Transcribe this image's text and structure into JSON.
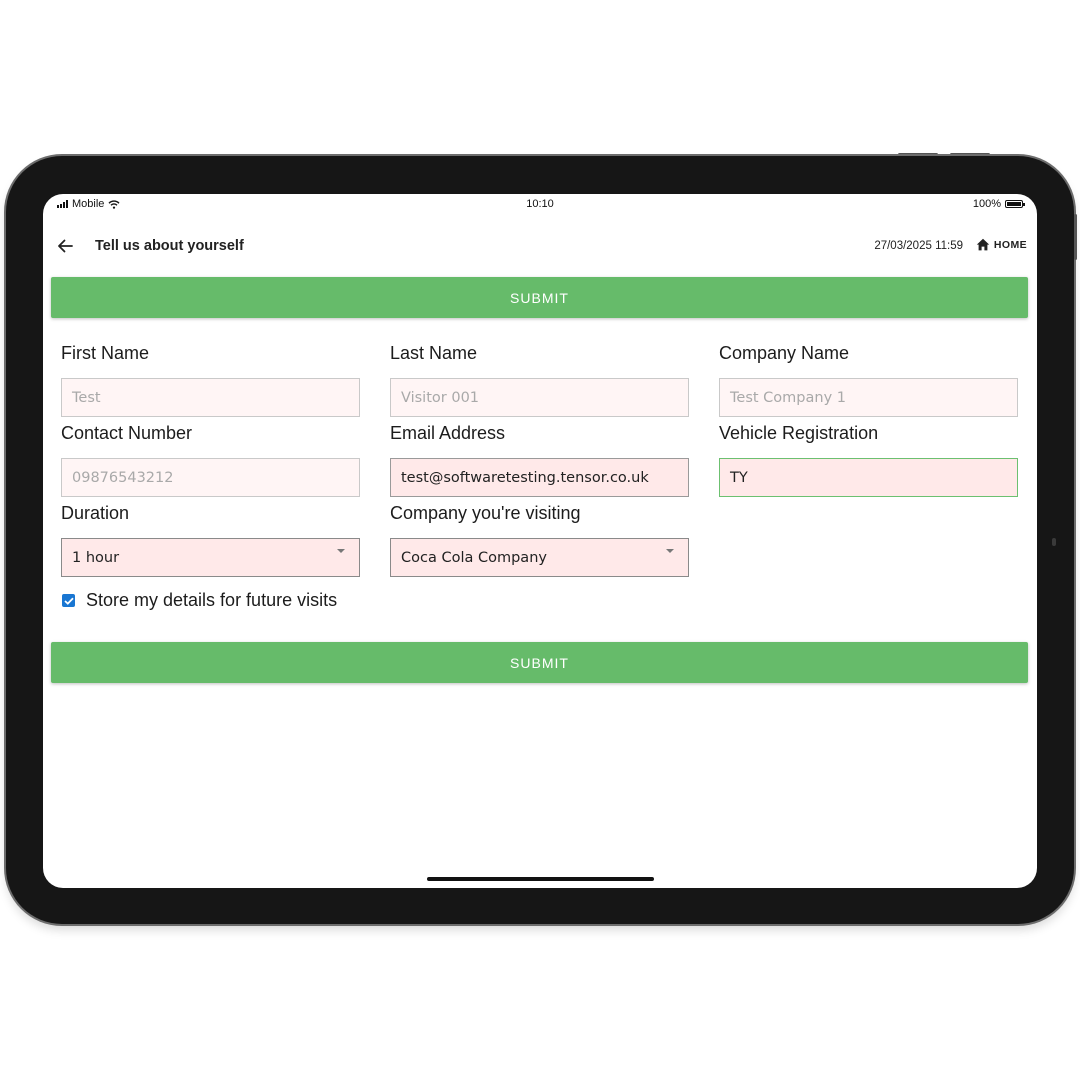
{
  "status_bar": {
    "carrier": "Mobile",
    "time": "10:10",
    "battery": "100%",
    "battery_level": 1.0
  },
  "header": {
    "title": "Tell us about yourself",
    "datetime": "27/03/2025 11:59",
    "home_label": "HOME"
  },
  "submit_label": "SUBMIT",
  "form": {
    "first_name": {
      "label": "First Name",
      "placeholder": "Test"
    },
    "last_name": {
      "label": "Last Name",
      "placeholder": "Visitor 001"
    },
    "company_name": {
      "label": "Company Name",
      "placeholder": "Test Company 1"
    },
    "contact_number": {
      "label": "Contact Number",
      "placeholder": "09876543212"
    },
    "email": {
      "label": "Email Address",
      "value": "test@softwaretesting.tensor.co.uk"
    },
    "vehicle_registration": {
      "label": "Vehicle Registration",
      "value": "TY"
    },
    "duration": {
      "label": "Duration",
      "value": "1 hour"
    },
    "company_visiting": {
      "label": "Company you're visiting",
      "value": "Coca Cola Company"
    },
    "store_details": {
      "label": "Store my details for future visits",
      "checked": true
    }
  },
  "colors": {
    "submit": "#66bb6a",
    "checkbox": "#1976d2",
    "field_bg": "#ffe9e9",
    "valid_border": "#6cc070"
  },
  "icons": {
    "back": "arrow-left-icon",
    "home": "home-icon",
    "wifi": "wifi-icon",
    "signal": "signal-icon",
    "battery": "battery-icon",
    "dropdown": "caret-down-icon",
    "checkbox": "checkmark-icon"
  }
}
